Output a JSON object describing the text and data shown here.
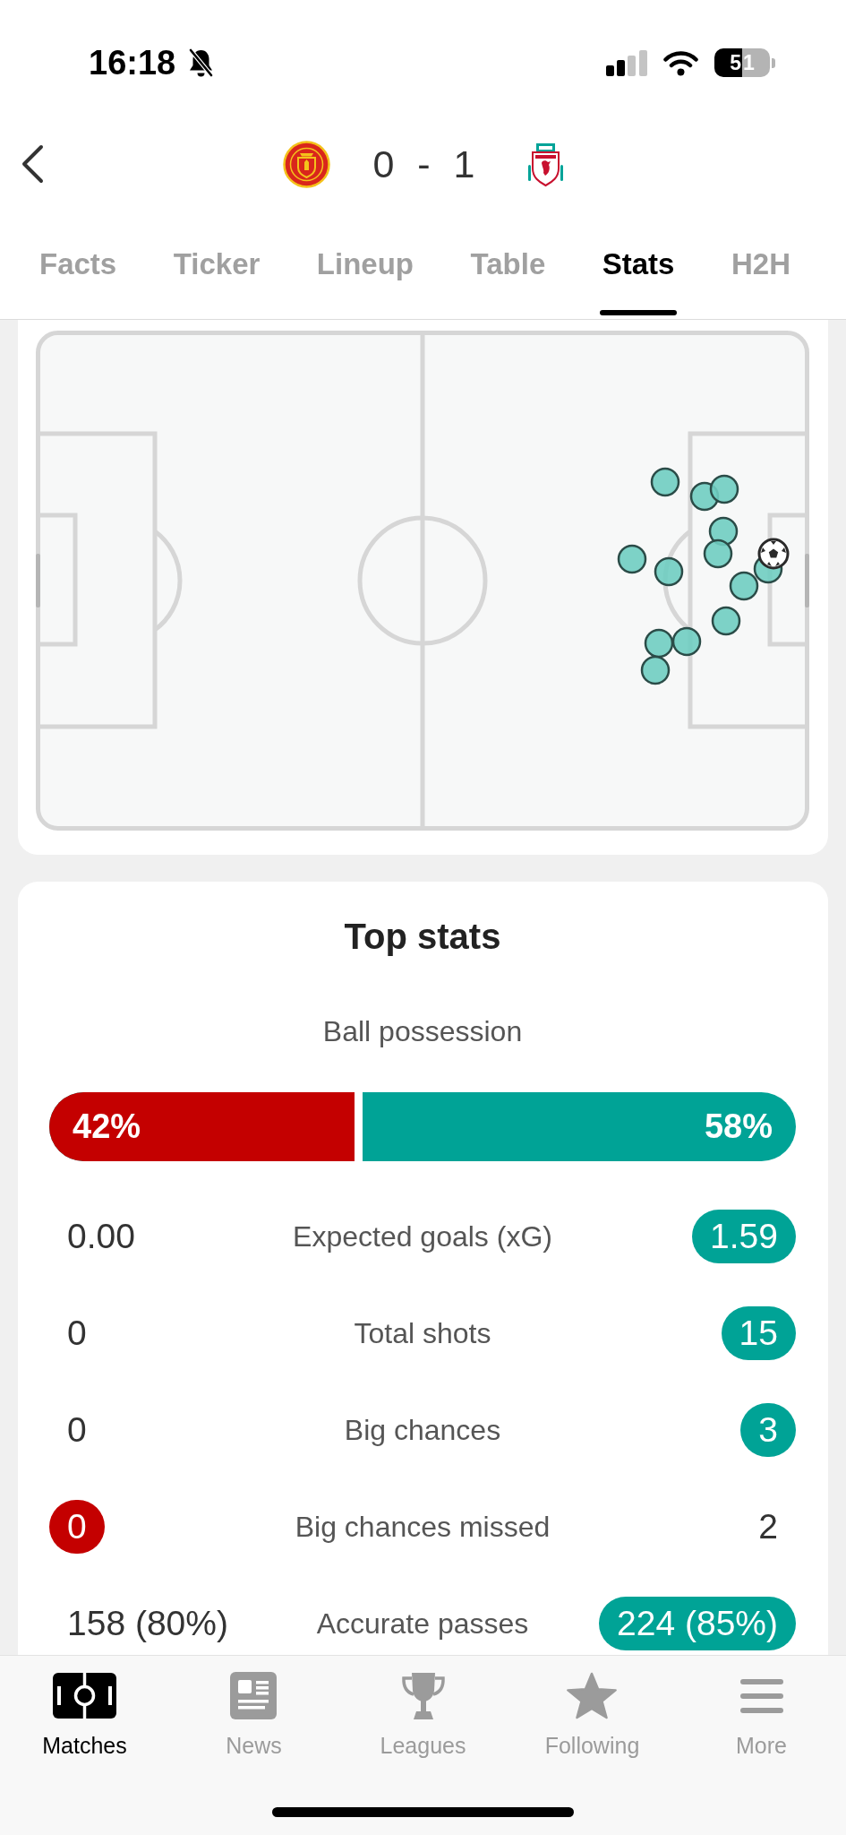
{
  "status_bar": {
    "time": "16:18",
    "battery": "51"
  },
  "match_header": {
    "score": "0 - 1"
  },
  "tabs": [
    {
      "label": "Facts",
      "selected": false
    },
    {
      "label": "Ticker",
      "selected": false
    },
    {
      "label": "Lineup",
      "selected": false
    },
    {
      "label": "Table",
      "selected": false
    },
    {
      "label": "Stats",
      "selected": true
    },
    {
      "label": "H2H",
      "selected": false
    }
  ],
  "top_stats": {
    "title": "Top stats",
    "possession": {
      "label": "Ball possession",
      "level": 0.42,
      "home": {
        "value": "42%",
        "color": "#c40000"
      },
      "away": {
        "value": "58%",
        "color": "#00a396"
      }
    },
    "rows": [
      {
        "label": "Expected goals (xG)",
        "home": {
          "value": "0.00",
          "highlighted": false
        },
        "away": {
          "value": "1.59",
          "highlighted": true
        }
      },
      {
        "label": "Total shots",
        "home": {
          "value": "0",
          "highlighted": false
        },
        "away": {
          "value": "15",
          "highlighted": true
        }
      },
      {
        "label": "Big chances",
        "home": {
          "value": "0",
          "highlighted": false
        },
        "away": {
          "value": "3",
          "highlighted": true
        }
      },
      {
        "label": "Big chances missed",
        "home": {
          "value": "0",
          "highlighted": true
        },
        "away": {
          "value": "2",
          "highlighted": false
        }
      },
      {
        "label": "Accurate passes",
        "home": {
          "value": "158 (80%)",
          "highlighted": false
        },
        "away": {
          "value": "224 (85%)",
          "highlighted": true
        }
      }
    ]
  },
  "bottom_nav": [
    {
      "label": "Matches",
      "selected": true
    },
    {
      "label": "News",
      "selected": false
    },
    {
      "label": "Leagues",
      "selected": false
    },
    {
      "label": "Following",
      "selected": false
    },
    {
      "label": "More",
      "selected": false
    }
  ]
}
